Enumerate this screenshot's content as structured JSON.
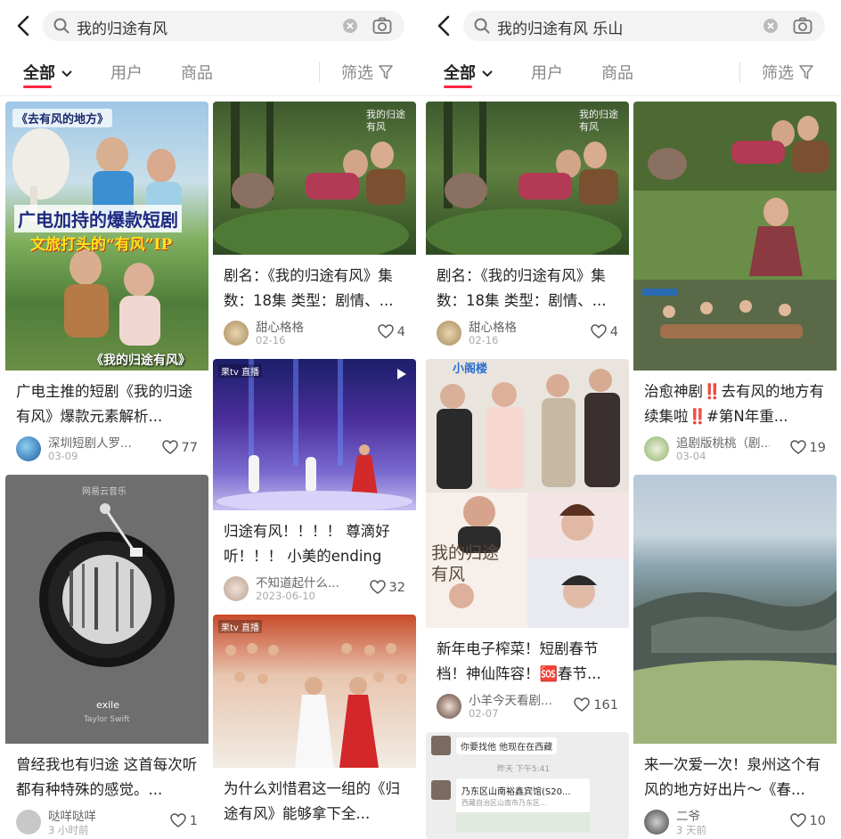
{
  "left": {
    "search_query": "我的归途有风",
    "tabs": {
      "all": "全部",
      "users": "用户",
      "products": "商品",
      "filter": "筛选"
    },
    "cards": [
      {
        "overlay_top": "《去有风的地方》",
        "overlay_mid": "广电加持的爆款短剧",
        "overlay_sub": "文旅打头的“有风”IP",
        "overlay_bottom": "《我的归途有风》",
        "title": "广电主推的短剧《我的归途有风》爆款元素解析...",
        "author": "深圳短剧人罗...",
        "date": "03-09",
        "likes": "77"
      },
      {
        "overlay_title": "exile",
        "overlay_artist": "Taylor Swift",
        "overlay_app": "网易云音乐",
        "title": "曾经我也有归途 这首每次听都有种特殊的感觉。...",
        "author": "哒咩哒咩",
        "date": "3 小时前",
        "likes": "1"
      },
      {
        "overlay_corner": "我的归途有风",
        "title": "剧名：《我的归途有风》集数：18集 类型：剧情、...",
        "author": "甜心格格",
        "date": "02-16",
        "likes": "4"
      },
      {
        "overlay_tv": "果tv 直播",
        "title": "归途有风！！！！ 尊滴好听！！！ 小美的ending真...",
        "author": "不知道起什么...",
        "date": "2023-06-10",
        "likes": "32"
      },
      {
        "overlay_tv": "果tv 直播",
        "title": "为什么刘惜君这一组的《归途有风》能够拿下全..."
      }
    ]
  },
  "right": {
    "search_query": "我的归途有风 乐山",
    "tabs": {
      "all": "全部",
      "users": "用户",
      "products": "商品",
      "filter": "筛选"
    },
    "cards": [
      {
        "overlay_corner": "我的归途有风",
        "title": "剧名：《我的归途有风》集数：18集 类型：剧情、...",
        "author": "甜心格格",
        "date": "02-16",
        "likes": "4"
      },
      {
        "overlay_top": "小阁楼",
        "overlay_bottom": "我的归途有风",
        "title": "新年电子榨菜！短剧春节档！神仙阵容！🆘春节...",
        "author": "小羊今天看剧...",
        "date": "02-07",
        "likes": "161"
      },
      {
        "overlay_chat1": "你要找他 他现在在西藏",
        "overlay_chat2": "昨天 下午5:41",
        "overlay_chat3": "乃东区山南裕鑫宾馆(S20...",
        "overlay_chat4": "西藏自治区山南市乃东区..."
      },
      {
        "title": "治愈神剧‼️去有风的地方有续集啦‼️#第N年重...",
        "author": "追剧版桃桃（剧...",
        "date": "03-04",
        "likes": "19"
      },
      {
        "title": "来一次爱一次！泉州这个有风的地方好出片～《春...",
        "author": "二爷",
        "date": "3 天前",
        "likes": "10"
      }
    ]
  },
  "colors": {
    "accent": "#ff2442",
    "text": "#222222",
    "muted": "#888888"
  }
}
